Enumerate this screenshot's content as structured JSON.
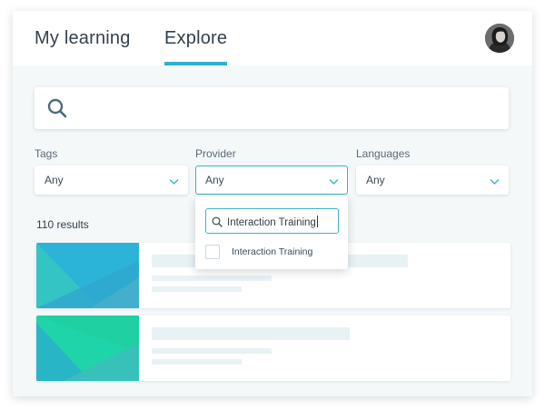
{
  "tabs": [
    {
      "label": "My learning",
      "active": false
    },
    {
      "label": "Explore",
      "active": true
    }
  ],
  "colors": {
    "accent": "#2fb0d0",
    "background": "#f4f8f9"
  },
  "search": {
    "placeholder": "",
    "icon": "search-icon"
  },
  "filters": [
    {
      "label": "Tags",
      "value": "Any"
    },
    {
      "label": "Provider",
      "value": "Any",
      "open": true
    },
    {
      "label": "Languages",
      "value": "Any"
    }
  ],
  "provider_dropdown": {
    "search_value": "Interaction Training",
    "options": [
      {
        "label": "Interaction Training",
        "checked": false
      }
    ]
  },
  "results": {
    "count_label": "110 results",
    "items": [
      {
        "title": "",
        "thumb": "blue-teal"
      },
      {
        "title": "",
        "thumb": "green-teal"
      }
    ]
  }
}
